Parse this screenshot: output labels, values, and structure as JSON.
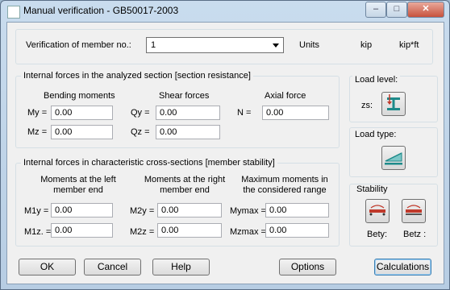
{
  "window": {
    "title": "Manual verification - GB50017-2003"
  },
  "titlebar_buttons": {
    "minimize": "–",
    "maximize": "□",
    "close": "✕"
  },
  "header": {
    "member_label": "Verification of member no.:",
    "member_value": "1",
    "units_label": "Units",
    "unit_force": "kip",
    "unit_moment": "kip*ft"
  },
  "section_resistance": {
    "title": "Internal forces in the analyzed section [section resistance]",
    "bending_heading": "Bending moments",
    "shear_heading": "Shear forces",
    "axial_heading": "Axial force",
    "my_label": "My =",
    "my_value": "0.00",
    "mz_label": "Mz =",
    "mz_value": "0.00",
    "qy_label": "Qy =",
    "qy_value": "0.00",
    "qz_label": "Qz =",
    "qz_value": "0.00",
    "n_label": "N =",
    "n_value": "0.00"
  },
  "member_stability": {
    "title": "Internal forces in characteristic cross-sections [member stability]",
    "left_heading": "Moments at the left member end",
    "right_heading": "Moments at the right member end",
    "max_heading": "Maximum moments in the considered range",
    "m1y_label": "M1y =",
    "m1y_value": "0.00",
    "m1z_label": "M1z. =",
    "m1z_value": "0.00",
    "m2y_label": "M2y =",
    "m2y_value": "0.00",
    "m2z_label": "M2z =",
    "m2z_value": "0.00",
    "mymax_label": "Mymax =",
    "mymax_value": "0.00",
    "mzmax_label": "Mzmax =",
    "mzmax_value": "0.00"
  },
  "load_level": {
    "title": "Load level:",
    "zs_label": "zs:"
  },
  "load_type": {
    "title": "Load type:"
  },
  "stability": {
    "title": "Stability",
    "bety_label": "Bety:",
    "betz_label": "Betz :"
  },
  "buttons": {
    "ok": "OK",
    "cancel": "Cancel",
    "help": "Help",
    "options": "Options",
    "calculations": "Calculations"
  },
  "colors": {
    "icon_teal": "#1e8a8a",
    "icon_red": "#c0392b"
  }
}
